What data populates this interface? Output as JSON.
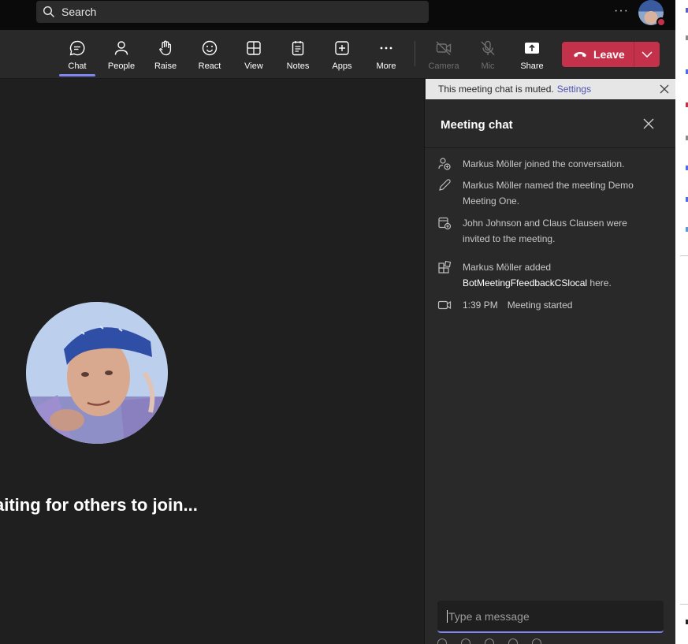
{
  "titlebar": {
    "search_label": "Search",
    "more_label": "···",
    "status_color": "#c4314b"
  },
  "toolbar": {
    "items": [
      {
        "label": "Chat",
        "icon": "chat-icon",
        "active": true
      },
      {
        "label": "People",
        "icon": "people-icon"
      },
      {
        "label": "Raise",
        "icon": "raise-hand-icon"
      },
      {
        "label": "React",
        "icon": "react-icon"
      },
      {
        "label": "View",
        "icon": "view-icon"
      },
      {
        "label": "Notes",
        "icon": "notes-icon"
      },
      {
        "label": "Apps",
        "icon": "apps-icon"
      },
      {
        "label": "More",
        "icon": "more-icon"
      },
      {
        "label": "Camera",
        "icon": "camera-off-icon",
        "disabled": true
      },
      {
        "label": "Mic",
        "icon": "mic-off-icon",
        "disabled": true
      },
      {
        "label": "Share",
        "icon": "share-icon"
      }
    ],
    "leave_label": "Leave",
    "accent_color": "#7f85f5",
    "leave_color": "#c4314b"
  },
  "stage": {
    "waiting_text": "aiting for others to join..."
  },
  "chat": {
    "banner_text": "This meeting chat is muted.",
    "banner_link": "Settings",
    "title": "Meeting chat",
    "events": [
      {
        "icon": "person-add-icon",
        "line1": "Markus Möller joined the conversation.",
        "line2": ""
      },
      {
        "icon": "pencil-icon",
        "line1": "Markus Möller named the meeting Demo",
        "line2": "Meeting One."
      },
      {
        "icon": "calendar-add-icon",
        "line1": "John Johnson and Claus Clausen were",
        "line2": "invited to the meeting."
      },
      {
        "icon": "app-add-icon",
        "line1": "Markus Möller added",
        "line2_bold": "BotMeetingFfeedbackCSlocal",
        "line2_rest": " here."
      },
      {
        "icon": "video-icon",
        "time": "1:39 PM",
        "line1": "Meeting started"
      }
    ],
    "composer_placeholder": "Type a message"
  }
}
